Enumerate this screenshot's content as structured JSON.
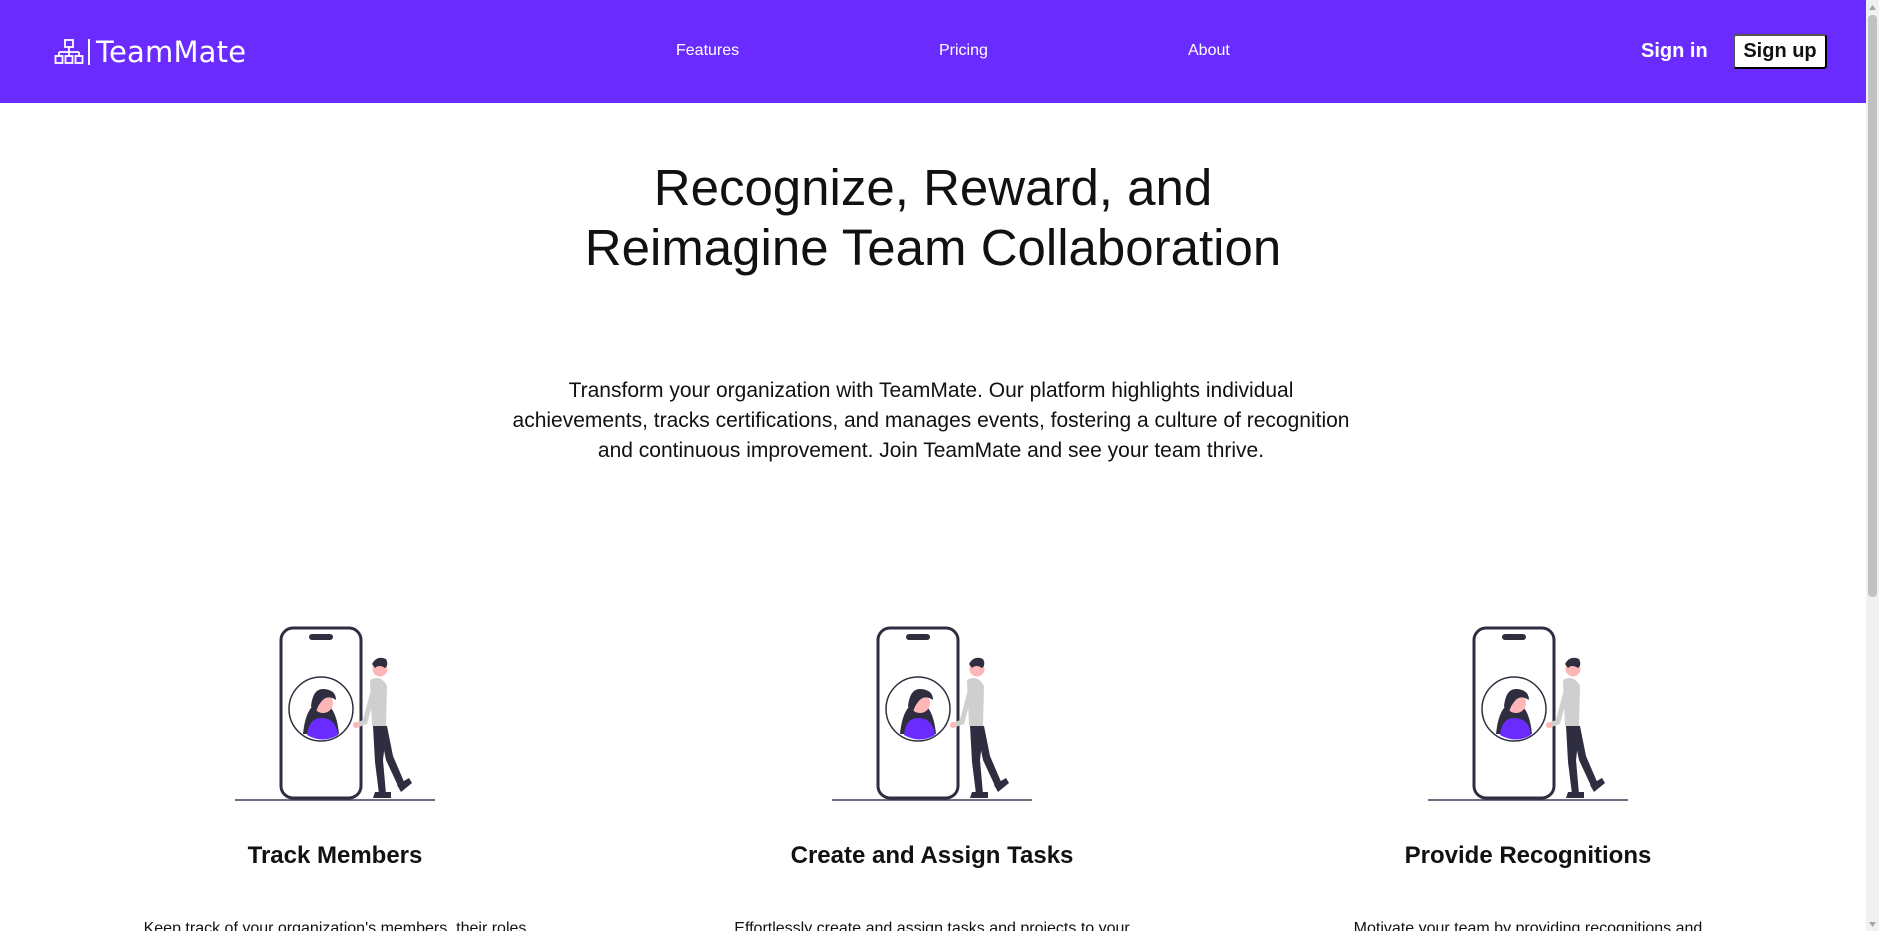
{
  "brand": {
    "logo_icon": "sitemap-icon",
    "name": "TeamMate",
    "nav_color": "#6a2bff"
  },
  "nav": {
    "features": "Features",
    "pricing": "Pricing",
    "about": "About",
    "sign_in": "Sign in",
    "sign_up": "Sign up"
  },
  "hero": {
    "title_line1": "Recognize, Reward, and",
    "title_line2": "Reimagine Team Collaboration",
    "description": "Transform your organization with TeamMate. Our platform highlights individual achievements, tracks certifications, and manages events, fostering a culture of recognition and continuous improvement. Join TeamMate and see your team thrive."
  },
  "features": [
    {
      "illustration": "phone-profile-illustration",
      "title": "Track Members",
      "description": "Keep track of your organization's members, their roles"
    },
    {
      "illustration": "phone-profile-illustration",
      "title": "Create and Assign Tasks",
      "description": "Effortlessly create and assign tasks and projects to your"
    },
    {
      "illustration": "phone-profile-illustration",
      "title": "Provide Recognitions",
      "description": "Motivate your team by providing recognitions and"
    }
  ]
}
